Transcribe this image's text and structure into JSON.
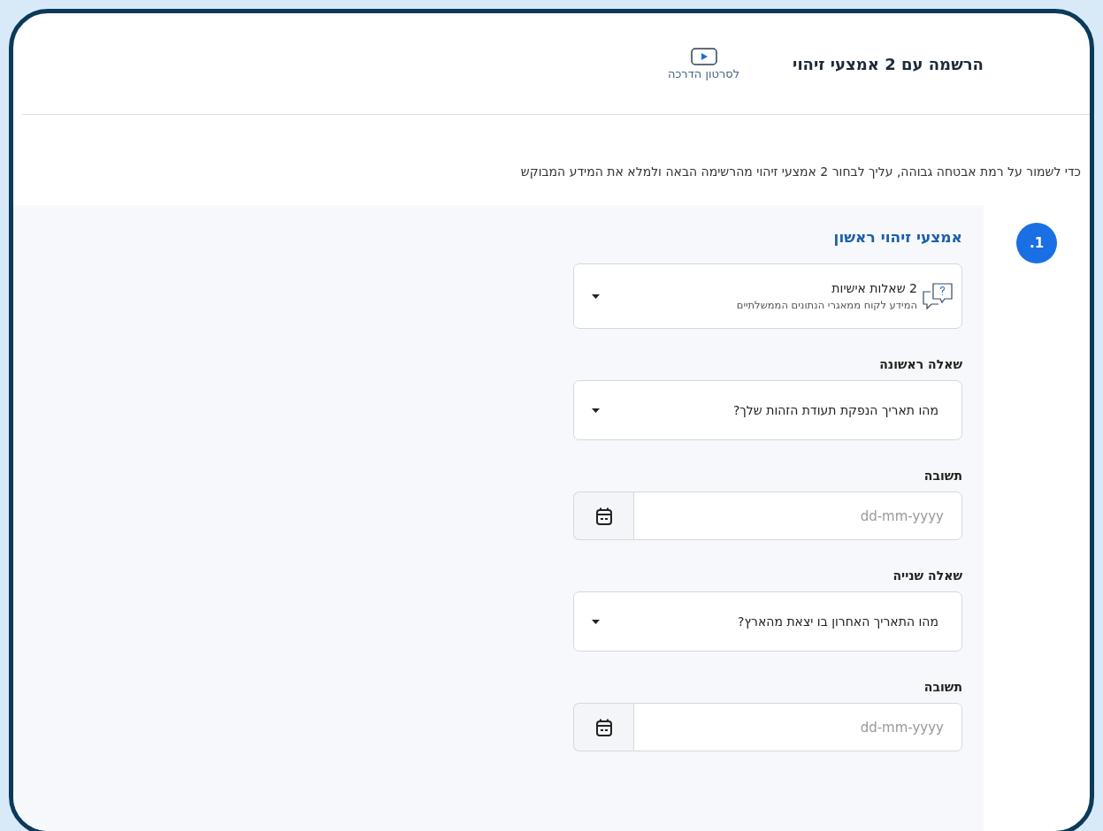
{
  "header": {
    "title": "הרשמה עם 2 אמצעי זיהוי",
    "video_link": "לסרטון הדרכה"
  },
  "intro": "כדי לשמור על רמת אבטחה גבוהה, עליך לבחור 2 אמצעי זיהוי מהרשימה הבאה ולמלא את המידע המבוקש",
  "section": {
    "number": "1.",
    "title": "אמצעי זיהוי ראשון",
    "fields": [
      {
        "kind": "method-select",
        "value": "2 שאלות אישיות",
        "description": "המידע לקוח ממאגרי הנתונים הממשלתיים"
      },
      {
        "kind": "select",
        "label": "שאלה ראשונה",
        "value": "מהו תאריך הנפקת תעודת הזהות שלך?"
      },
      {
        "kind": "date",
        "label": "תשובה",
        "placeholder": "dd-mm-yyyy"
      },
      {
        "kind": "select",
        "label": "שאלה שנייה",
        "value": "מהו התאריך האחרון בו יצאת מהארץ?"
      },
      {
        "kind": "date",
        "label": "תשובה",
        "placeholder": "dd-mm-yyyy"
      }
    ]
  }
}
